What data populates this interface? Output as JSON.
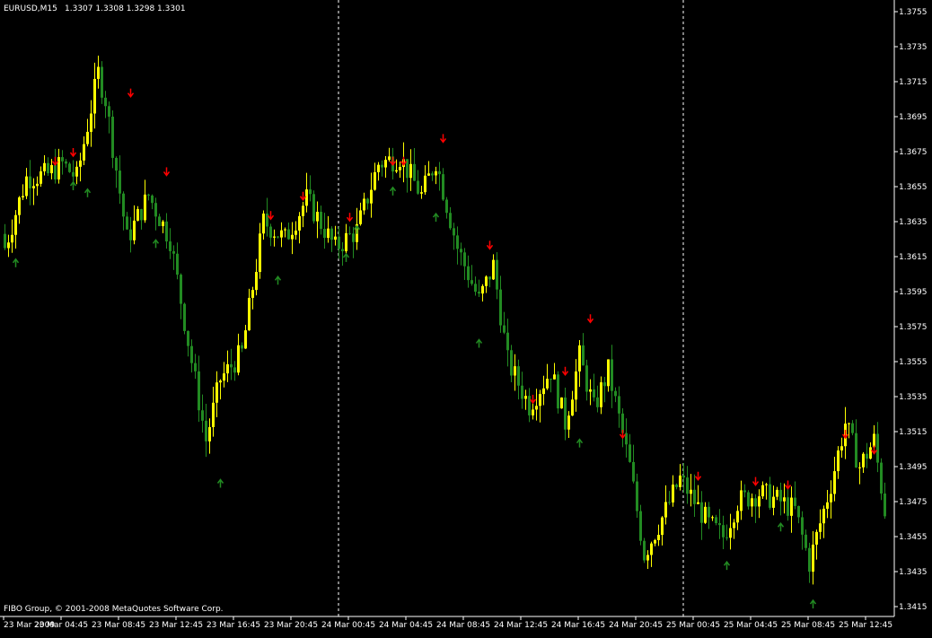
{
  "header": {
    "symbol": "EURUSD,M15",
    "ohlc": "1.3307 1.3308 1.3298 1.3301"
  },
  "footer": {
    "copyright": "FIBO Group, © 2001-2008 MetaQuotes Software Corp."
  },
  "colors": {
    "background": "#000000",
    "bull_candle": "#ffff00",
    "bear_candle": "#228b22",
    "up_arrow": "#228b22",
    "down_arrow": "#ff0000",
    "axis": "#ffffff",
    "separator": "#ffffff"
  },
  "chart_data": {
    "type": "candlestick",
    "timeframe": "M15",
    "ylim": [
      1.3405,
      1.3765
    ],
    "y_ticks": [
      "1.3755",
      "1.3735",
      "1.3715",
      "1.3695",
      "1.3675",
      "1.3655",
      "1.3635",
      "1.3615",
      "1.3595",
      "1.3575",
      "1.3555",
      "1.3535",
      "1.3515",
      "1.3495",
      "1.3475",
      "1.3455",
      "1.3435",
      "1.3415"
    ],
    "x_ticks": [
      "23 Mar 2009",
      "23 Mar 04:45",
      "23 Mar 08:45",
      "23 Mar 12:45",
      "23 Mar 16:45",
      "23 Mar 20:45",
      "24 Mar 00:45",
      "24 Mar 04:45",
      "24 Mar 08:45",
      "24 Mar 12:45",
      "24 Mar 16:45",
      "24 Mar 20:45",
      "25 Mar 00:45",
      "25 Mar 04:45",
      "25 Mar 08:45",
      "25 Mar 12:45"
    ],
    "day_separators": [
      "24 Mar 2009",
      "25 Mar 2009"
    ],
    "bars_per_tick": 16,
    "close_path": [
      [
        0,
        1.362
      ],
      [
        6,
        1.366
      ],
      [
        12,
        1.3662
      ],
      [
        16,
        1.3668
      ],
      [
        20,
        1.366
      ],
      [
        26,
        1.372
      ],
      [
        28,
        1.3705
      ],
      [
        34,
        1.3625
      ],
      [
        40,
        1.365
      ],
      [
        46,
        1.3625
      ],
      [
        52,
        1.3555
      ],
      [
        56,
        1.351
      ],
      [
        60,
        1.3545
      ],
      [
        66,
        1.356
      ],
      [
        72,
        1.3635
      ],
      [
        78,
        1.3625
      ],
      [
        84,
        1.3648
      ],
      [
        92,
        1.362
      ],
      [
        98,
        1.363
      ],
      [
        104,
        1.3668
      ],
      [
        110,
        1.3672
      ],
      [
        116,
        1.365
      ],
      [
        120,
        1.367
      ],
      [
        126,
        1.362
      ],
      [
        132,
        1.359
      ],
      [
        136,
        1.361
      ],
      [
        140,
        1.3555
      ],
      [
        146,
        1.353
      ],
      [
        152,
        1.355
      ],
      [
        156,
        1.352
      ],
      [
        160,
        1.3558
      ],
      [
        164,
        1.3528
      ],
      [
        168,
        1.355
      ],
      [
        174,
        1.3495
      ],
      [
        178,
        1.3445
      ],
      [
        184,
        1.347
      ],
      [
        188,
        1.3488
      ],
      [
        192,
        1.3475
      ],
      [
        196,
        1.3462
      ],
      [
        200,
        1.3455
      ],
      [
        204,
        1.3475
      ],
      [
        210,
        1.348
      ],
      [
        216,
        1.3475
      ],
      [
        220,
        1.347
      ],
      [
        224,
        1.344
      ],
      [
        230,
        1.3485
      ],
      [
        234,
        1.352
      ],
      [
        238,
        1.3495
      ],
      [
        242,
        1.351
      ],
      [
        245,
        1.347
      ]
    ],
    "up_arrows": [
      [
        3,
        1.3611
      ],
      [
        19,
        1.3655
      ],
      [
        23,
        1.3651
      ],
      [
        42,
        1.3622
      ],
      [
        60,
        1.3485
      ],
      [
        76,
        1.3601
      ],
      [
        95,
        1.3614
      ],
      [
        98,
        1.363
      ],
      [
        108,
        1.3652
      ],
      [
        120,
        1.3637
      ],
      [
        132,
        1.3565
      ],
      [
        160,
        1.3508
      ],
      [
        201,
        1.3438
      ],
      [
        216,
        1.346
      ],
      [
        225,
        1.3416
      ]
    ],
    "down_arrows": [
      [
        14,
        1.367
      ],
      [
        19,
        1.3675
      ],
      [
        35,
        1.3709
      ],
      [
        45,
        1.3664
      ],
      [
        74,
        1.3639
      ],
      [
        83,
        1.365
      ],
      [
        96,
        1.3638
      ],
      [
        108,
        1.367
      ],
      [
        111,
        1.367
      ],
      [
        122,
        1.3683
      ],
      [
        135,
        1.3622
      ],
      [
        147,
        1.3534
      ],
      [
        156,
        1.355
      ],
      [
        163,
        1.358
      ],
      [
        172,
        1.3514
      ],
      [
        193,
        1.349
      ],
      [
        209,
        1.3487
      ],
      [
        218,
        1.3485
      ],
      [
        234,
        1.3514
      ],
      [
        242,
        1.3505
      ]
    ]
  }
}
